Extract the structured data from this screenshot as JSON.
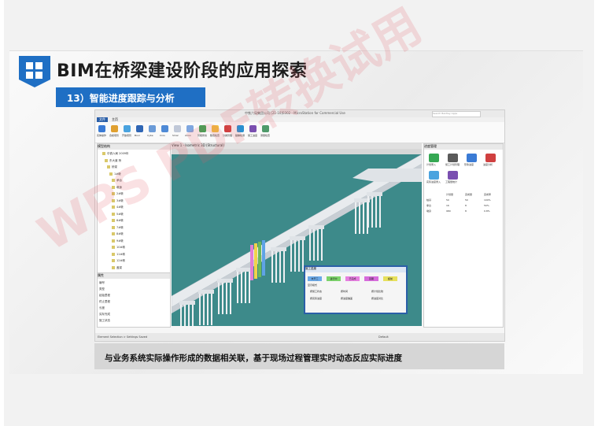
{
  "slide": {
    "title": "BIM在桥梁建设阶段的应用探索",
    "subtitle": "13）智能进度跟踪与分析",
    "caption": "与业务系统实际操作形成的数据相关联，基于现场过程管理实时动态反应实际进度",
    "watermark": "WPS PDF转换试用"
  },
  "app": {
    "window_title": "中铁六局集团公司 [21-10]0302 - MicroStation for Commercial Use",
    "search_placeholder": "Search Bentley Apps",
    "tabs": [
      "文件",
      "主页"
    ],
    "ribbon_labels": [
      "实体操作",
      "合模项管理",
      "开放项管理",
      "Boolean Union",
      "Cyber Drone",
      "Cross Detail",
      "Smart Check",
      "Annotation Ribbon",
      "智能修剪",
      "数值检查",
      "分类管理",
      "碰撞检测",
      "施工进度",
      "测量检查"
    ],
    "left_panel_title": "模型结构",
    "tree_items": [
      "中铁六局 2009年",
      "东大道 桥",
      "桥梁",
      "1#墩",
      "承台",
      "墩身",
      "2#墩",
      "3#墩",
      "4#墩",
      "5#墩",
      "6#墩",
      "7#墩",
      "8#墩",
      "9#墩",
      "10#墩",
      "11#墩",
      "12#墩",
      "盖梁",
      "箱梁"
    ],
    "props_title": "属性",
    "props_rows": [
      "编号",
      "类型",
      "起始里程",
      "终止里程",
      "长度",
      "实际完成",
      "施工状态"
    ],
    "viewport_title": "View 1 - Isometric 3D (Structural)",
    "right_panel_title": "进度管理",
    "right_buttons": [
      "计划录入",
      "施工计划管理",
      "形象进度",
      "进度分析",
      "实际进度录入",
      "工程量统计"
    ],
    "right_table_headers": [
      "",
      "计划量",
      "完成量",
      "完成率"
    ],
    "right_table_rows": [
      [
        "桩基",
        "50",
        "50",
        "100%"
      ],
      [
        "承台",
        "16",
        "8",
        "50%"
      ],
      [
        "墩身",
        "980",
        "8",
        "0.8%"
      ]
    ],
    "status_left": "Element Selection > Settings Saved",
    "status_right": "Default",
    "dialog": {
      "title": "施工进度",
      "chips": [
        "未开工",
        "进行中",
        "已完成",
        "延期",
        "超前"
      ],
      "section": "显示模式",
      "options": [
        "按施工状态",
        "按时间",
        "按计划比较",
        "按实际进度",
        "按进度偏差",
        "按进度对比"
      ]
    }
  },
  "colors": {
    "brand_blue": "#1f6fc4",
    "viewport_teal": "#3d8a8a",
    "chip_colors": [
      "#6aa9e8",
      "#7bd36a",
      "#e67ee0",
      "#d66bdb",
      "#e7e05c"
    ]
  }
}
